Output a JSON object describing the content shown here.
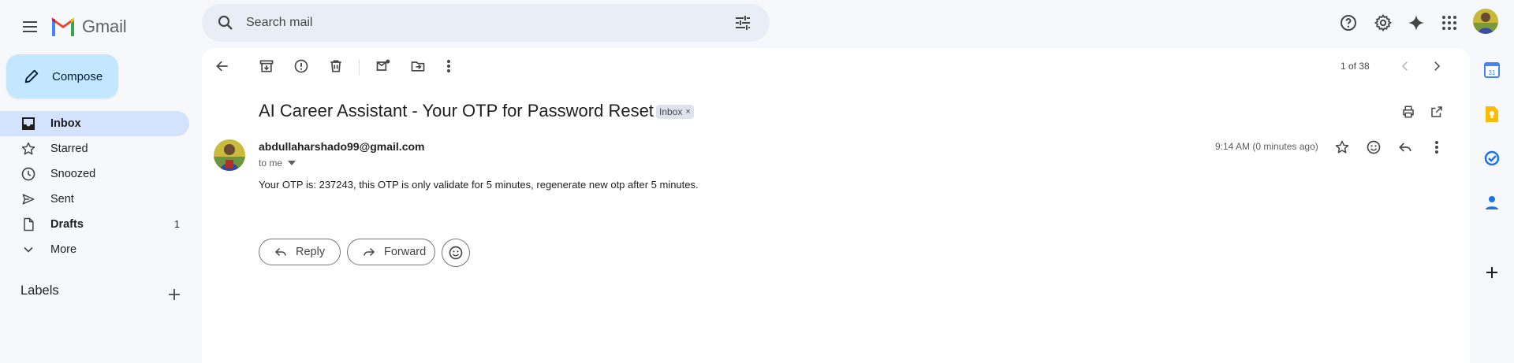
{
  "app": {
    "name": "Gmail",
    "brand_colors": {
      "red": "#ea4335",
      "blue": "#4285f4",
      "green": "#34a853",
      "yellow": "#fbbc04"
    }
  },
  "header": {
    "search_placeholder": "Search mail",
    "icons": [
      "menu-icon",
      "search-icon",
      "search-filter-icon",
      "help-icon",
      "settings-icon",
      "gemini-sparkle-icon",
      "apps-grid-icon"
    ]
  },
  "sidebar": {
    "compose_label": "Compose",
    "items": [
      {
        "label": "Inbox",
        "icon": "inbox-icon",
        "active": true,
        "count": ""
      },
      {
        "label": "Starred",
        "icon": "star-icon",
        "active": false,
        "count": ""
      },
      {
        "label": "Snoozed",
        "icon": "clock-icon",
        "active": false,
        "count": ""
      },
      {
        "label": "Sent",
        "icon": "send-icon",
        "active": false,
        "count": ""
      },
      {
        "label": "Drafts",
        "icon": "draft-icon",
        "active": false,
        "count": "1"
      },
      {
        "label": "More",
        "icon": "chevron-down-icon",
        "active": false,
        "count": ""
      }
    ],
    "labels_title": "Labels"
  },
  "toolbar": {
    "pager": "1 of 38",
    "icons": [
      "back-arrow-icon",
      "archive-icon",
      "report-spam-icon",
      "delete-icon",
      "mark-unread-icon",
      "move-to-icon",
      "more-vert-icon",
      "newer-chevron-icon",
      "older-chevron-icon"
    ]
  },
  "email": {
    "subject": "AI Career Assistant - Your OTP for Password Reset",
    "label_chip": "Inbox",
    "label_chip_close": "×",
    "sender": "abdullaharshado99@gmail.com",
    "recipient": "to me",
    "time": "9:14 AM (0 minutes ago)",
    "body": "Your OTP is: 237243, this OTP is only validate for 5 minutes, regenerate new otp after 5 minutes.",
    "reply_label": "Reply",
    "forward_label": "Forward"
  },
  "right_rail": {
    "icons": [
      "calendar-icon",
      "keep-icon",
      "tasks-icon",
      "contacts-icon",
      "add-addon-icon"
    ],
    "calendar_day": "31"
  }
}
